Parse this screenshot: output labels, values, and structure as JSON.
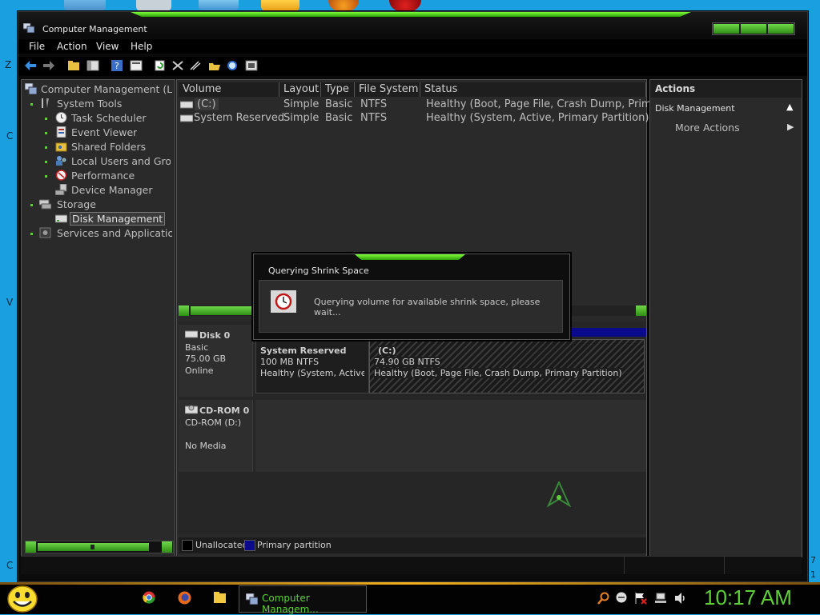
{
  "desktop": {
    "side_letters": [
      "Z",
      "C",
      "V",
      "C"
    ],
    "right_letters": [
      "7",
      "1"
    ]
  },
  "window": {
    "title": "Computer Management",
    "accent_color": "#5fd038"
  },
  "menu": [
    "File",
    "Action",
    "View",
    "Help"
  ],
  "toolbar_icons": [
    "back-arrow-icon",
    "forward-arrow-icon",
    "up-folder-icon",
    "show-hide-tree-icon",
    "help-icon",
    "properties-icon",
    "refresh-icon",
    "delete-icon",
    "connect-icon",
    "open-icon",
    "search-icon",
    "settings-icon"
  ],
  "tree": {
    "root": "Computer Management (Loc",
    "system_tools": "System Tools",
    "task_scheduler": "Task Scheduler",
    "event_viewer": "Event Viewer",
    "shared_folders": "Shared Folders",
    "local_users": "Local Users and Grou",
    "performance": "Performance",
    "device_manager": "Device Manager",
    "storage": "Storage",
    "disk_management": "Disk Management",
    "services": "Services and Application"
  },
  "volume_table": {
    "columns": [
      "Volume",
      "Layout",
      "Type",
      "File System",
      "Status"
    ],
    "rows": [
      {
        "volume": "(C:)",
        "layout": "Simple",
        "type": "Basic",
        "fs": "NTFS",
        "status": "Healthy (Boot, Page File, Crash Dump, Primary"
      },
      {
        "volume": "System Reserved",
        "layout": "Simple",
        "type": "Basic",
        "fs": "NTFS",
        "status": "Healthy (System, Active, Primary Partition)"
      }
    ]
  },
  "disk0": {
    "name": "Disk 0",
    "kind": "Basic",
    "size": "75.00 GB",
    "state": "Online",
    "partitions": [
      {
        "name": "System Reserved",
        "size": "100 MB NTFS",
        "status": "Healthy (System, Active, P"
      },
      {
        "name": "(C:)",
        "size": "74.90 GB NTFS",
        "status": "Healthy (Boot, Page File, Crash Dump, Primary Partition)"
      }
    ]
  },
  "cdrom0": {
    "name": "CD-ROM 0",
    "drive": "CD-ROM (D:)",
    "media": "No Media"
  },
  "legend": {
    "unallocated": "Unallocated",
    "primary": "Primary partition",
    "primary_color": "#0a0a8a"
  },
  "actions": {
    "header": "Actions",
    "section": "Disk Management",
    "more": "More Actions"
  },
  "dialog": {
    "title": "Querying Shrink Space",
    "message": "Querying volume for available shrink space, please wait..."
  },
  "taskbar": {
    "active_task": "Computer Managem...",
    "clock": "10:17 AM",
    "clock_color": "#5fd038",
    "tray_icons": [
      "search-icon",
      "messenger-icon",
      "flag-icon",
      "network-icon",
      "volume-icon"
    ]
  }
}
